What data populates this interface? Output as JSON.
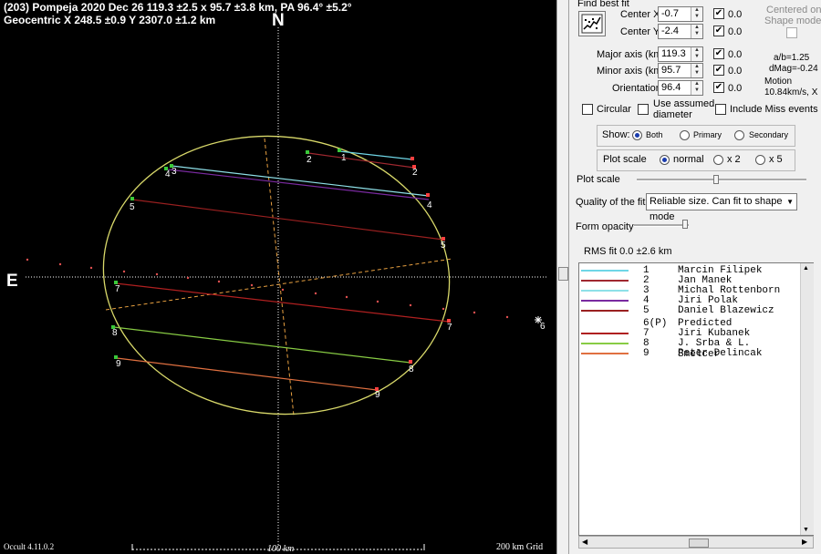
{
  "plot": {
    "title_line1": "(203) Pompeja  2020 Dec 26   119.3 ±2.5 x 95.7 ±3.8 km,  PA 96.4° ±5.2°",
    "title_line2": "Geocentric  X  248.5 ±0.9  Y 2307.0 ±1.2 km",
    "north": "N",
    "east": "E",
    "version": "Occult 4.11.0.2",
    "scale_label": "100 km",
    "grid_label": "200 km Grid",
    "chord_markers": [
      "1",
      "2",
      "3",
      "4",
      "5",
      "6",
      "7",
      "8",
      "9"
    ],
    "colors": {
      "ellipse": "#d9d96a",
      "axes": "#ffffff",
      "predicted": "#e8a040"
    }
  },
  "panel": {
    "find_best_fit": "Find best fit",
    "center_x_label": "Center X",
    "center_x_value": "-0.7",
    "center_y_label": "Center Y",
    "center_y_value": "-2.4",
    "major_label": "Major axis (km)",
    "major_value": "119.3",
    "minor_label": "Minor axis (km)",
    "minor_value": "95.7",
    "orient_label": "Orientation",
    "orient_value": "96.4",
    "step_x": "0.0",
    "step_y": "0.0",
    "step_major": "0.0",
    "step_minor": "0.0",
    "step_orient": "0.0",
    "centered_label_1": "Centered on",
    "centered_label_2": "Shape model",
    "ab_ratio": "a/b=1.25",
    "dmag": "dMag=-0.24",
    "motion_1": "Motion",
    "motion_2": "10.84km/s, X",
    "circular": "Circular",
    "use_assumed_1": "Use assumed",
    "use_assumed_2": "diameter",
    "include_miss": "Include Miss events",
    "show_label": "Show:",
    "show_both": "Both",
    "show_primary": "Primary",
    "show_secondary": "Secondary",
    "plot_scale_group": "Plot scale",
    "scale_normal": "normal",
    "scale_x2": "x 2",
    "scale_x5": "x 5",
    "plot_scale_slider": "Plot scale",
    "quality_label": "Quality of the fit",
    "quality_value": "Reliable size. Can fit to shape mode",
    "form_opacity": "Form opacity",
    "rms_fit": "RMS fit 0.0 ±2.6 km"
  },
  "legend": [
    {
      "num": "1",
      "name": "Marcin Filipek",
      "color": "#6fd6e6"
    },
    {
      "num": "2",
      "name": "Jan Manek",
      "color": "#a02830"
    },
    {
      "num": "3",
      "name": "Michal Rottenborn",
      "color": "#8ee0e8"
    },
    {
      "num": "4",
      "name": "Jiri Polak",
      "color": "#7a2aa0"
    },
    {
      "num": "5",
      "name": "Daniel Blazewicz",
      "color": "#9a2020"
    },
    {
      "num": "6(P)",
      "name": "Predicted",
      "color": "#ffffff"
    },
    {
      "num": "7",
      "name": "Jiri Kubanek",
      "color": "#b02020"
    },
    {
      "num": "8",
      "name": "J. Srba & L. Smelcer",
      "color": "#88cc44"
    },
    {
      "num": "9",
      "name": "Peter Delincak",
      "color": "#e07040"
    }
  ]
}
